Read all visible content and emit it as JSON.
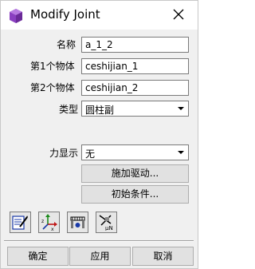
{
  "window": {
    "title": "Modify Joint"
  },
  "form": {
    "name_label": "名称",
    "name_value": "a_1_2",
    "body1_label": "第1个物体",
    "body1_value": "ceshijian_1",
    "body2_label": "第2个物体",
    "body2_value": "ceshijian_2",
    "type_label": "类型",
    "type_value": "圆柱副",
    "force_display_label": "力显示",
    "force_display_value": "无"
  },
  "buttons": {
    "impose_motion": "施加驱动...",
    "initial_conditions": "初始条件..."
  },
  "toolbar": {
    "icons": [
      "edit-properties-icon",
      "coordinate-axes-icon",
      "joint-bracket-icon",
      "friction-mu-icon"
    ],
    "friction_text": "μN"
  },
  "footer": {
    "ok": "确定",
    "apply": "应用",
    "cancel": "取消"
  }
}
